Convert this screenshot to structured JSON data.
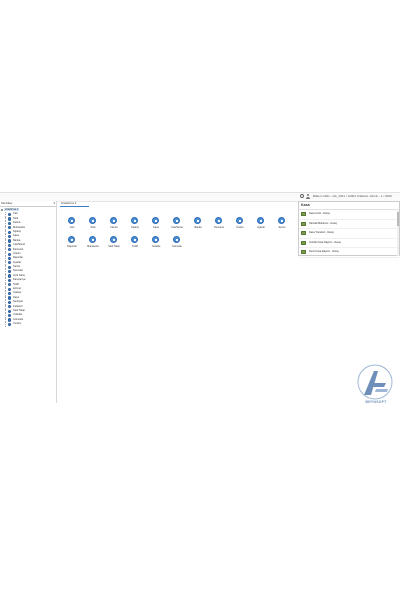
{
  "header": {
    "left_text": "Baltem 2021 - tab_2021 / 12004",
    "right_text": "Kullanici: Admin - 1 / 2009"
  },
  "sidebar": {
    "title": "Modüller",
    "root": "Arastirma 1",
    "items": [
      "Cari",
      "Stok",
      "Fatura",
      "Muhasebe",
      "Sipariş",
      "Kasa",
      "Banka",
      "Cek/Senet",
      "Personel",
      "Üretim",
      "Raporlar",
      "Ayarlar",
      "Servis",
      "Tanımlar",
      "Hızlı Satış",
      "Kampanya",
      "Teklif",
      "Hizmet",
      "İrsaliye",
      "Depo",
      "Sevkiyat",
      "Kullanici",
      "Stok Takip",
      "Yedekle",
      "Güncelle",
      "Yardım"
    ]
  },
  "main": {
    "tab_label": "Arastirma 1",
    "tiles": [
      {
        "label": "Cari"
      },
      {
        "label": "Stok"
      },
      {
        "label": "Fatura"
      },
      {
        "label": "Sipariş"
      },
      {
        "label": "Kasa"
      },
      {
        "label": "Cek/Senet"
      },
      {
        "label": "Banka"
      },
      {
        "label": "Personel"
      },
      {
        "label": "Üretim"
      },
      {
        "label": "Ayarlar"
      },
      {
        "label": "Servis"
      },
      {
        "label": "Tanımlar"
      },
      {
        "label": "Raporlar"
      },
      {
        "label": "Muhasebe"
      },
      {
        "label": "Stok Takip"
      },
      {
        "label": "Teklif"
      },
      {
        "label": "Yedekle"
      },
      {
        "label": "Güncelle"
      }
    ]
  },
  "panel": {
    "title": "Kasa",
    "rows": [
      "Kasa Girisi - Detay",
      "Tahsilat Makbuzu - Detay",
      "Kasa Transferi - Detay",
      "Günlük Kasa Raporu - Detay",
      "Devir Kasa Raporu - Detay"
    ]
  },
  "branding": {
    "logo_text": "BEYNSOFT",
    "brand_color": "#6d8fb9",
    "accent_color": "#3a7ec8"
  }
}
